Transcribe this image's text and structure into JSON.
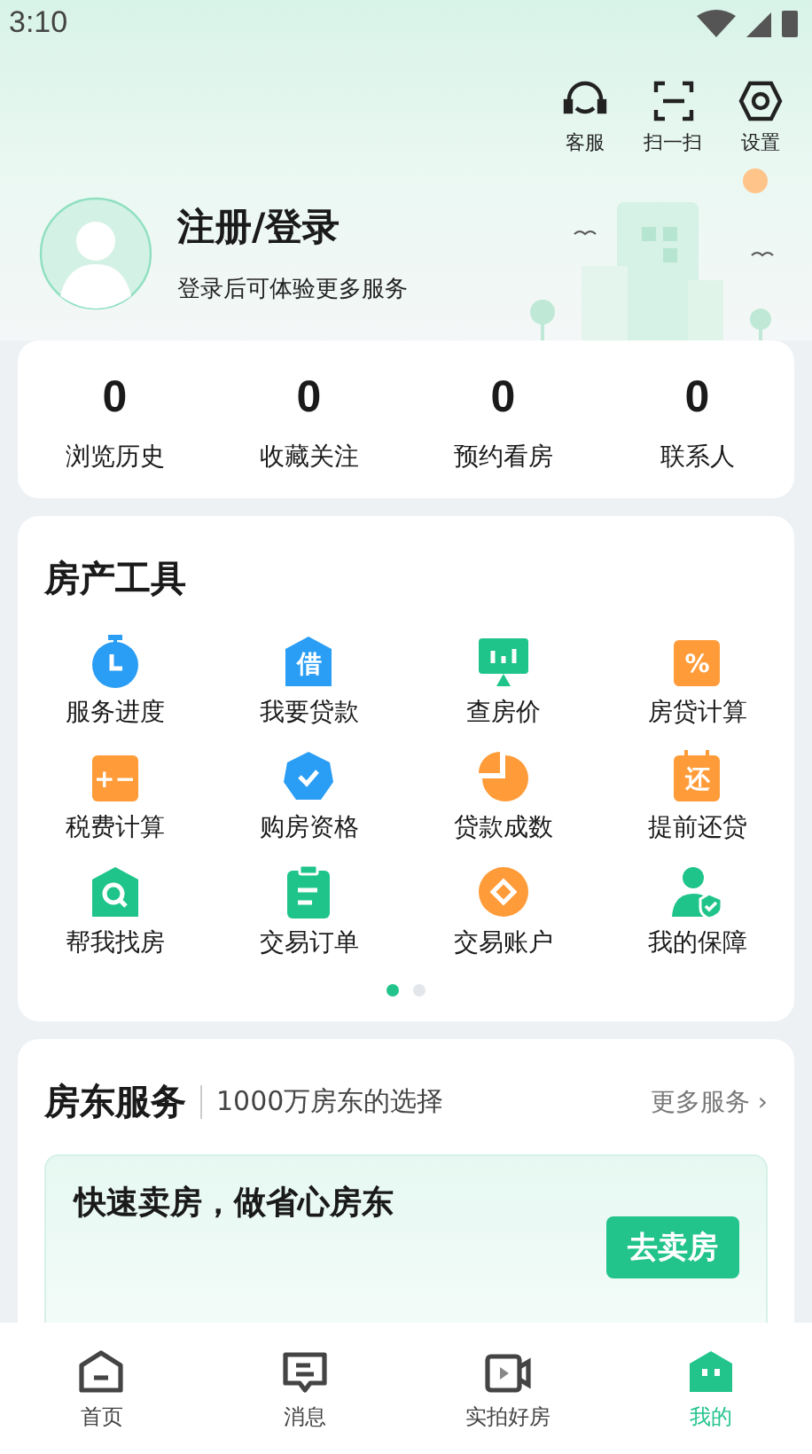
{
  "status_bar": {
    "time": "3:10"
  },
  "header_actions": [
    {
      "label": "客服",
      "kind": "headset"
    },
    {
      "label": "扫一扫",
      "kind": "scan"
    },
    {
      "label": "设置",
      "kind": "settings"
    }
  ],
  "profile": {
    "title": "注册/登录",
    "subtitle": "登录后可体验更多服务"
  },
  "stats": [
    {
      "value": "0",
      "label": "浏览历史"
    },
    {
      "value": "0",
      "label": "收藏关注"
    },
    {
      "value": "0",
      "label": "预约看房"
    },
    {
      "value": "0",
      "label": "联系人"
    }
  ],
  "tools": {
    "title": "房产工具",
    "items": [
      {
        "label": "服务进度",
        "kind": "clock",
        "color": "#2a9df4"
      },
      {
        "label": "我要贷款",
        "kind": "house",
        "color": "#2a9df4",
        "glyph": "借"
      },
      {
        "label": "查房价",
        "kind": "monitor",
        "color": "#1fc48a"
      },
      {
        "label": "房贷计算",
        "kind": "square",
        "color": "#ff9b38",
        "glyph": "%"
      },
      {
        "label": "税费计算",
        "kind": "square",
        "color": "#ff9b38",
        "glyph": "+−"
      },
      {
        "label": "购房资格",
        "kind": "hexagon",
        "color": "#2a9df4"
      },
      {
        "label": "贷款成数",
        "kind": "pie",
        "color": "#ff9b38"
      },
      {
        "label": "提前还贷",
        "kind": "calendar",
        "color": "#ff9b38",
        "glyph": "还"
      },
      {
        "label": "帮我找房",
        "kind": "search",
        "color": "#1fc48a"
      },
      {
        "label": "交易订单",
        "kind": "clipboard",
        "color": "#1fc48a"
      },
      {
        "label": "交易账户",
        "kind": "coin",
        "color": "#ff9b38"
      },
      {
        "label": "我的保障",
        "kind": "shield",
        "color": "#1fc48a"
      }
    ],
    "pages": [
      {
        "selected": true
      },
      {
        "selected": false
      }
    ]
  },
  "landlord": {
    "title": "房东服务",
    "tagline": "1000万房东的选择",
    "more": "更多服务 ›",
    "promo": {
      "title": "快速卖房，做省心房东",
      "button": "去卖房"
    }
  },
  "nav": [
    {
      "label": "首页",
      "kind": "home",
      "selected": false
    },
    {
      "label": "消息",
      "kind": "message",
      "selected": false
    },
    {
      "label": "实拍好房",
      "kind": "video",
      "selected": false
    },
    {
      "label": "我的",
      "kind": "mine",
      "selected": true
    }
  ]
}
